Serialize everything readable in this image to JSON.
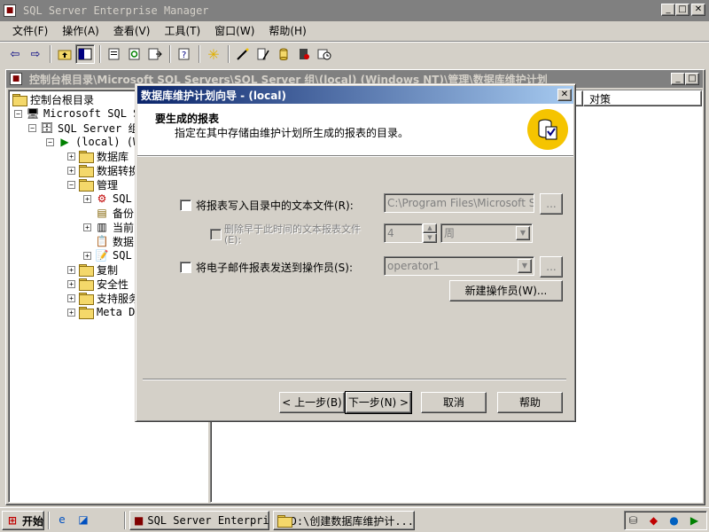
{
  "app": {
    "title": "SQL Server Enterprise Manager"
  },
  "menu": [
    "文件(F)",
    "操作(A)",
    "查看(V)",
    "工具(T)",
    "窗口(W)",
    "帮助(H)"
  ],
  "console": {
    "title": "控制台根目录\\Microsoft SQL Servers\\SQL Server 组\\(local) (Windows NT)\\管理\\数据库维护计划",
    "tree": [
      {
        "label": "控制台根目录"
      },
      {
        "label": "Microsoft SQL Ser"
      },
      {
        "label": "SQL Server 组"
      },
      {
        "label": "(local) (W"
      },
      {
        "label": "数据库"
      },
      {
        "label": "数据转换"
      },
      {
        "label": "管理"
      },
      {
        "label": "SQL"
      },
      {
        "label": "备份"
      },
      {
        "label": "当前"
      },
      {
        "label": "数据"
      },
      {
        "label": "SQL"
      },
      {
        "label": "复制"
      },
      {
        "label": "安全性"
      },
      {
        "label": "支持服务"
      },
      {
        "label": "Meta Da"
      }
    ],
    "column_header": "对策"
  },
  "wizard": {
    "title": "数据库维护计划向导 - (local)",
    "header_title": "要生成的报表",
    "header_subtitle": "指定在其中存储由维护计划所生成的报表的目录。",
    "write_report_label": "将报表写入目录中的文本文件(R):",
    "write_report_path": "C:\\Program Files\\Microsoft SQL Se",
    "delete_older_label_1": "删除早于此时间的文本报表文件",
    "delete_older_label_2": "(E):",
    "delete_older_value": "4",
    "delete_older_unit": "周",
    "email_label": "将电子邮件报表发送到操作员(S):",
    "email_operator": "operator1",
    "browse_label": "...",
    "new_operator_label": "新建操作员(W)...",
    "back_label": "< 上一步(B)",
    "next_label": "下一步(N) >",
    "cancel_label": "取消",
    "help_label": "帮助"
  },
  "taskbar": {
    "start_label": "开始",
    "tasks": [
      "SQL Server Enterpri...",
      "D:\\创建数据库维护计..."
    ]
  }
}
